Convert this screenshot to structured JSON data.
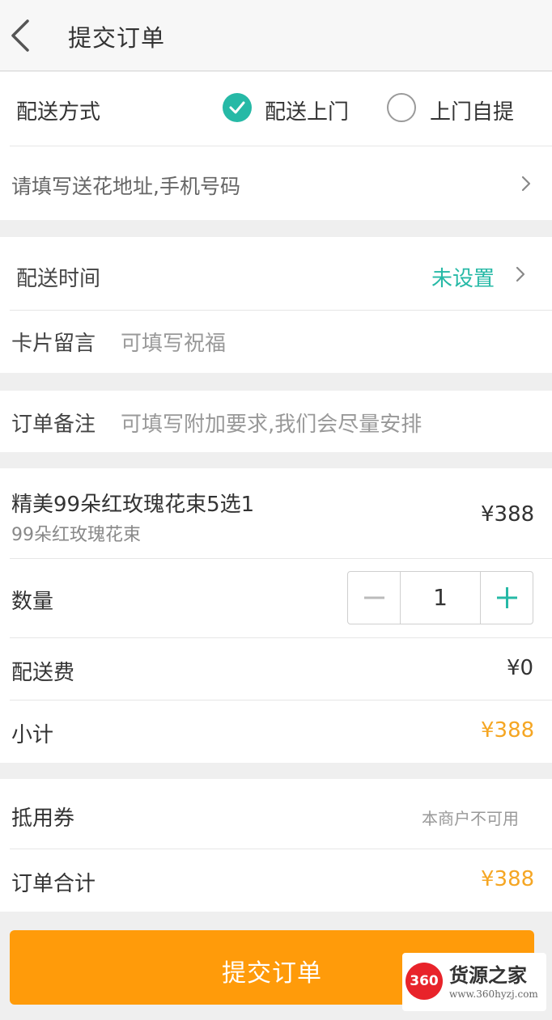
{
  "header": {
    "title": "提交订单",
    "back_icon": "chevron-left-icon"
  },
  "delivery": {
    "method_label": "配送方式",
    "options": [
      {
        "label": "配送上门",
        "selected": true
      },
      {
        "label": "上门自提",
        "selected": false
      }
    ],
    "address_placeholder": "请填写送花地址,手机号码"
  },
  "schedule": {
    "time_label": "配送时间",
    "time_value": "未设置",
    "card_label": "卡片留言",
    "card_placeholder": "可填写祝福"
  },
  "note": {
    "label": "订单备注",
    "placeholder": "可填写附加要求,我们会尽量安排"
  },
  "product": {
    "name": "精美99朵红玫瑰花束5选1",
    "variant": "99朵红玫瑰花束",
    "price": "¥388",
    "quantity_label": "数量",
    "quantity": "1",
    "shipping_label": "配送费",
    "shipping_value": "¥0",
    "subtotal_label": "小计",
    "subtotal_value": "¥388"
  },
  "totals": {
    "coupon_label": "抵用券",
    "coupon_value": "本商户不可用",
    "total_label": "订单合计",
    "total_value": "¥388"
  },
  "submit_label": "提交订单",
  "watermark": {
    "logo": "360",
    "name": "货源之家",
    "url": "www.360hyzj.com"
  },
  "colors": {
    "accent": "#26b9a6",
    "orange": "#ff9b0a",
    "price_orange": "#f5a623"
  }
}
